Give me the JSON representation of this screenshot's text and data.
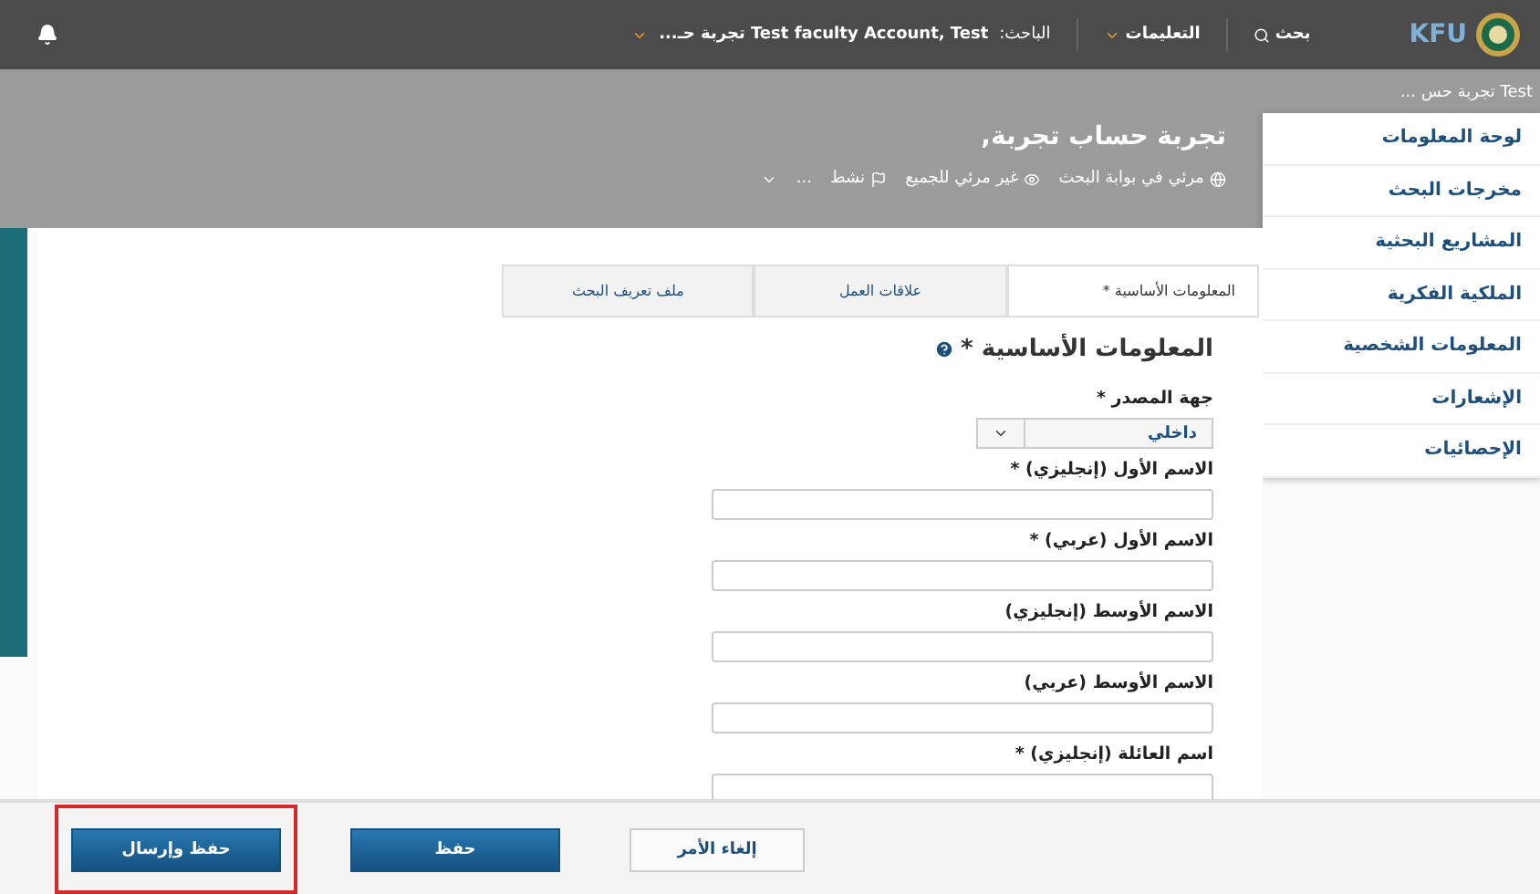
{
  "top_bar": {
    "logo_text": "KFU",
    "search": "بحث",
    "help": "التعليمات",
    "researcher_label": "الباحث:",
    "researcher_name": "Test faculty Account, Test تجربة حـ..."
  },
  "breadcrumb": "Test تجربة حس ...",
  "profile": {
    "title": "تجربة حساب تجربة,",
    "meta": [
      {
        "kind": "globe",
        "label": "مرئي في بوابة البحث"
      },
      {
        "kind": "eye",
        "label": "غير مرئي للجميع"
      },
      {
        "kind": "flag",
        "label": "نشط"
      },
      {
        "kind": "more",
        "label": "..."
      }
    ]
  },
  "sidebar": {
    "items": [
      {
        "label": "لوحة المعلومات"
      },
      {
        "label": "مخرجات البحث"
      },
      {
        "label": "المشاريع البحثية"
      },
      {
        "label": "الملكية الفكرية"
      },
      {
        "label": "المعلومات الشخصية"
      },
      {
        "label": "الإشعارات"
      },
      {
        "label": "الإحصائيات"
      }
    ]
  },
  "tabs": [
    {
      "label": "المعلومات الأساسية *",
      "selected": true
    },
    {
      "label": "علاقات العمل",
      "selected": false
    },
    {
      "label": "ملف تعريف البحث",
      "selected": false
    }
  ],
  "form": {
    "heading": "المعلومات الأساسية *",
    "fields": [
      {
        "kind": "select",
        "label": "جهة المصدر *",
        "value": "داخلي"
      },
      {
        "kind": "text",
        "label": "الاسم الأول (إنجليزي) *"
      },
      {
        "kind": "text",
        "label": "الاسم الأول (عربي) *"
      },
      {
        "kind": "text",
        "label": "الاسم الأوسط (إنجليزي)"
      },
      {
        "kind": "text",
        "label": "الاسم الأوسط (عربي)"
      },
      {
        "kind": "text",
        "label": "اسم العائلة (إنجليزي) *"
      }
    ]
  },
  "buttons": [
    {
      "kind": "secondary",
      "label": "إلغاء الأمر",
      "highlighted": false
    },
    {
      "kind": "primary",
      "label": "حفظ",
      "highlighted": false
    },
    {
      "kind": "primary",
      "label": "حفظ وإرسال",
      "highlighted": true
    }
  ]
}
